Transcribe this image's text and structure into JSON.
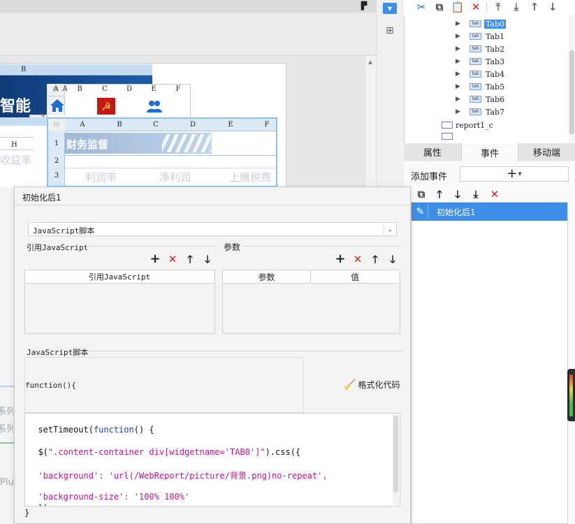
{
  "canvas": {
    "column_b_label": "B",
    "grid1_cols": [
      "A",
      "B",
      "C",
      "D",
      "E",
      "F"
    ],
    "grid1_row": "1",
    "grid1_row2": "2",
    "title_fragment": "智能",
    "left_col_h": "H",
    "left_text1": "收益率",
    "grid2_cols": [
      "A",
      "B",
      "C",
      "D",
      "E",
      "F"
    ],
    "grid2_rows": [
      "1",
      "2",
      "3"
    ],
    "banner_text": "财务监督",
    "row3_texts": [
      "利润率",
      "净利润",
      "上缴税费"
    ],
    "side_texts": [
      "系列",
      "系列",
      "Plu"
    ]
  },
  "tree": {
    "items": [
      "Tab0",
      "Tab1",
      "Tab2",
      "Tab3",
      "Tab4",
      "Tab5",
      "Tab6",
      "Tab7"
    ],
    "icon_text": "tab",
    "report_item": "report1_c",
    "selected": "Tab0"
  },
  "right_tabs": [
    "属性",
    "事件",
    "移动端"
  ],
  "events": {
    "add_event_label": "添加事件",
    "list": [
      "初始化后1"
    ]
  },
  "dialog": {
    "title": "初始化后1",
    "type_select": "JavaScript脚本",
    "ref_section": "引用JavaScript",
    "ref_column": "引用JavaScript",
    "param_section": "参数",
    "param_columns": [
      "参数",
      "值"
    ],
    "script_section": "JavaScript脚本",
    "func_header": "function(){",
    "format_label": "格式化代码",
    "code": {
      "l1_a": "setTimeout(",
      "l1_kw": "function",
      "l1_b": "() {",
      "l2_a": "$(",
      "l2_str": "\".content-container div[widgetname='TAB0']\"",
      "l2_b": ").css({",
      "l3_str": "'background': 'url(/WebReport/picture/背景.png)no-repeat',",
      "l4_str": "'background-size': '100% 100%'",
      "l5": "})"
    },
    "closing": "}"
  },
  "colors": {
    "accent": "#3d8ee8",
    "selection": "#3d8ee8",
    "keyword": "#1f3ec4",
    "string": "#b8168c",
    "delete": "#e02020"
  }
}
